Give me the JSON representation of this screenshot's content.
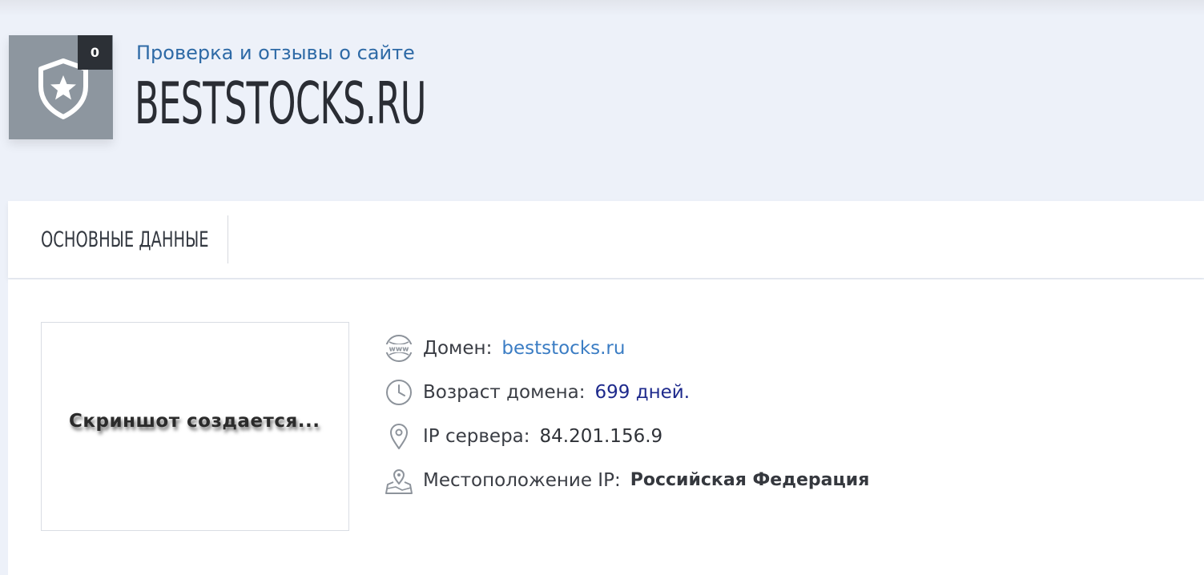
{
  "header": {
    "review_count": "0",
    "subtitle": "Проверка и отзывы о сайте",
    "domain_title": "BESTSTOCKS.RU",
    "badge_icon": "shield-star-icon"
  },
  "tabs": [
    {
      "label": "ОСНОВНЫЕ ДАННЫЕ"
    }
  ],
  "screenshot": {
    "status_text": "Скриншот создается..."
  },
  "info": {
    "domain": {
      "icon": "www-icon",
      "label": "Домен:",
      "value": "beststocks.ru"
    },
    "age": {
      "icon": "clock-icon",
      "label": "Возраст домена:",
      "value": "699 дней."
    },
    "ip": {
      "icon": "map-pin-icon",
      "label": "IP сервера:",
      "value": "84.201.156.9"
    },
    "location": {
      "icon": "map-location-icon",
      "label": "Местоположение IP:",
      "value": "Российская Федерация"
    }
  },
  "colors": {
    "background": "#edf1f9",
    "accent_blue": "#2e6aa6",
    "link_blue": "#3b7dc4",
    "days_blue": "#1e2a8c",
    "badge_gray": "#8d969f",
    "count_dark": "#2c3036"
  }
}
